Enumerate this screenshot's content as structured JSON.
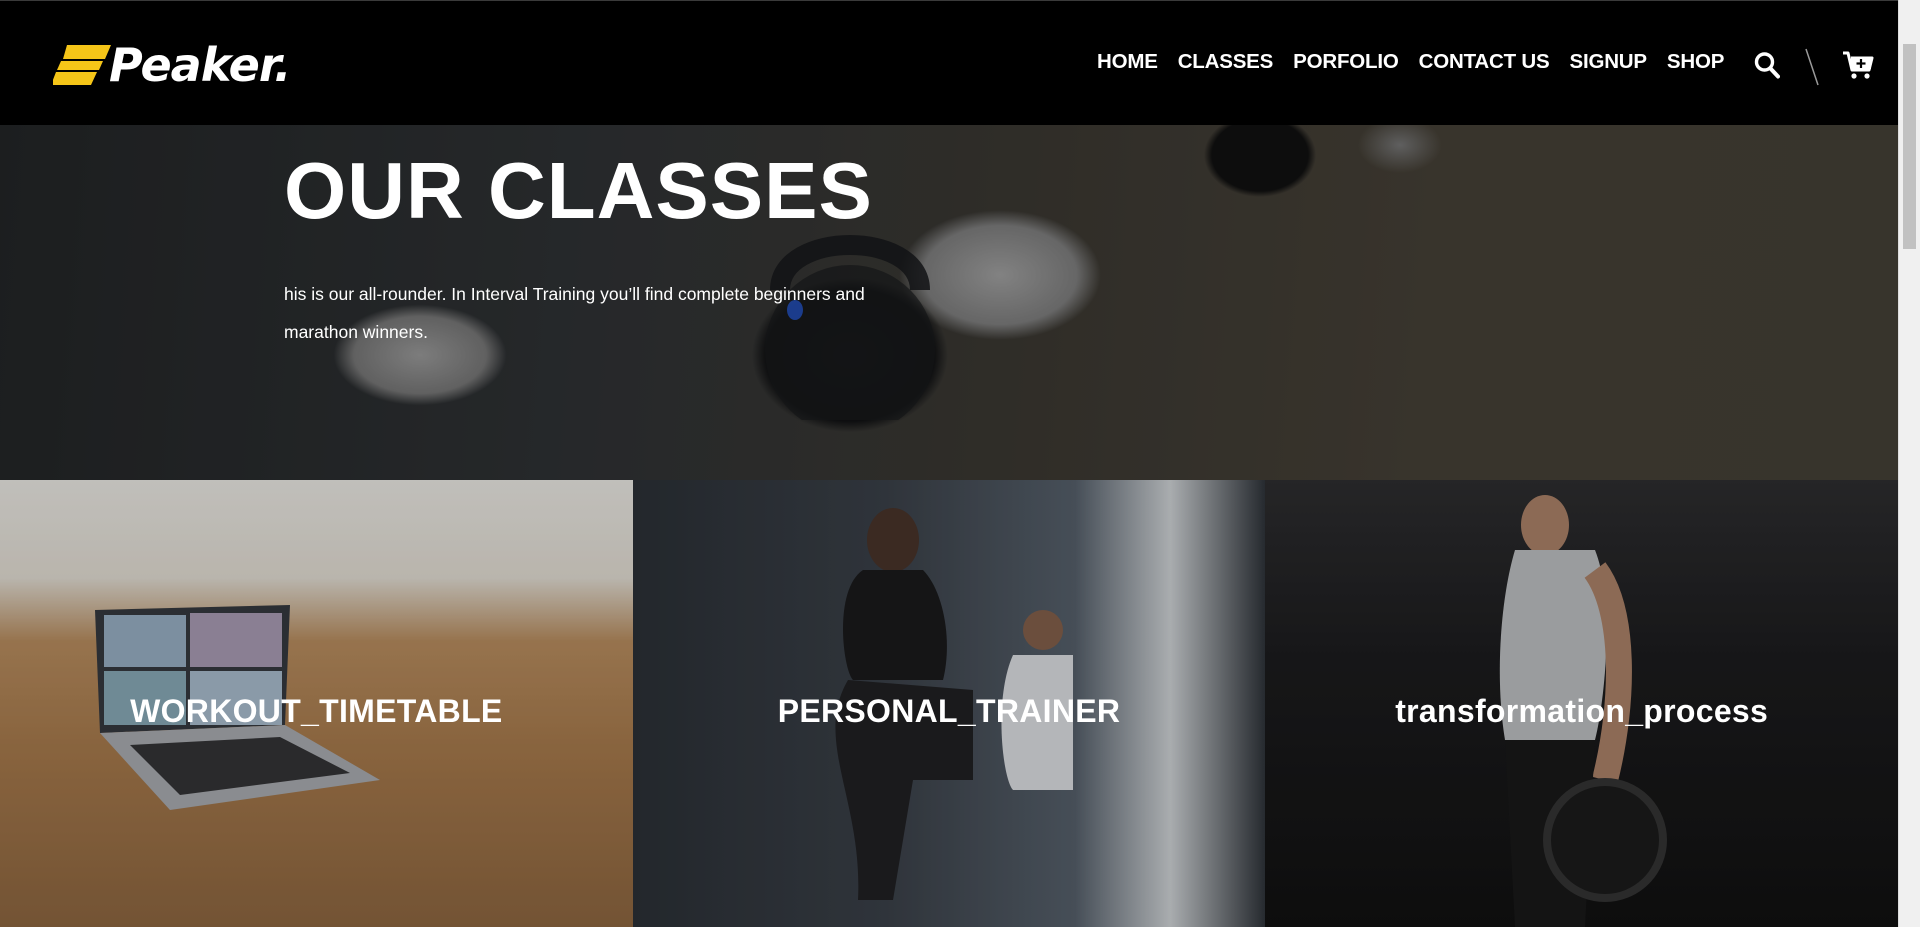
{
  "brand": {
    "name": "Peaker.",
    "accent": "#f5c518"
  },
  "nav": [
    {
      "label": "HOME"
    },
    {
      "label": "CLASSES"
    },
    {
      "label": "PORFOLIO"
    },
    {
      "label": "CONTACT US"
    },
    {
      "label": "SIGNUP"
    },
    {
      "label": "SHOP"
    }
  ],
  "header_icons": [
    "search-icon",
    "divider-slash-icon",
    "cart-icon"
  ],
  "hero": {
    "title": "OUR CLASSES",
    "description": "his is our all-rounder. In Interval Training you’ll find complete beginners and marathon winners."
  },
  "cards": [
    {
      "title": "WORKOUT_TIMETABLE"
    },
    {
      "title": "PERSONAL_TRAINER"
    },
    {
      "title": "transformation_process"
    }
  ]
}
